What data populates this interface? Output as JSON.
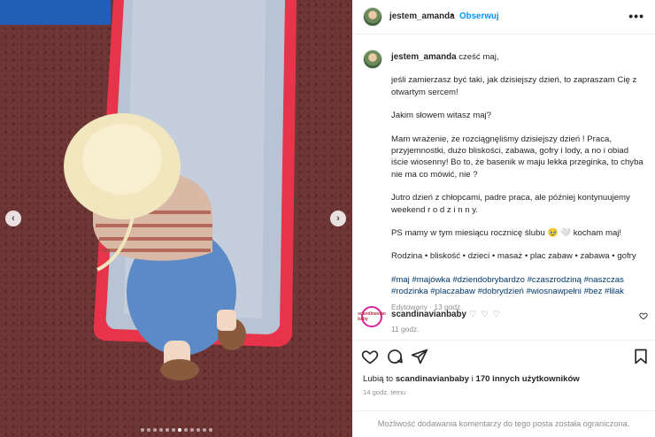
{
  "post": {
    "image": {
      "alt": "Child in a sun hat climbing a playground slide",
      "slide_count": 12,
      "active_slide": 7,
      "prev_label": "‹",
      "next_label": "›"
    },
    "header": {
      "username": "jestem_amanda",
      "separator": "•",
      "follow_label": "Obserwuj",
      "more_label": "•••"
    },
    "caption": {
      "username": "jestem_amanda",
      "first_line": "cześć maj,",
      "paragraphs": [
        "jeśli zamierzasz być taki, jak dzisiejszy dzień, to zapraszam Cię z otwartym sercem!",
        "Jakim słowem witasz maj?",
        "Mam wrażenie, że rozciągnęliśmy dzisiejszy dzień ! Praca, przyjemnostki, dużo bliskości, zabawa, gofry i lody, a no i obiad iście wiosenny! Bo to, że basenik w maju lekka przeginka, to chyba nie ma co mówić, nie ?",
        "Jutro dzień z chłopcami, padre praca, ale później kontynuujemy weekend r o d z i n n y.",
        "PS mamy w tym miesiącu rocznicę ślubu 🥹 🤍 kocham maj!",
        "Rodzina • bliskość • dzieci • masaż • plac zabaw • zabawa • gofry"
      ],
      "hashtags": "#maj #majówka #dziendobrybardzo #czaszrodziną #naszczas #rodzinka #placzabaw #dobrydzień #wiosnawpełni #bez #lilak",
      "edited": "Edytowany · 13 godz."
    },
    "comment": {
      "username": "scandinavianbaby",
      "hearts": "♡ ♡ ♡",
      "time": "11 godz.",
      "avatar_text": "scandinavian baby",
      "like_icon": "heart-icon"
    },
    "actions": {
      "icons": [
        "heart-icon",
        "comment-icon",
        "share-icon",
        "bookmark-icon"
      ],
      "likes_prefix": "Lubią to",
      "likes_user": "scandinavianbaby",
      "likes_mid": "i",
      "likes_others": "170 innych użytkowników",
      "time_ago": "14 godz. temu"
    },
    "restricted": "Możliwość dodawania komentarzy do tego posta została ograniczona.",
    "colors": {
      "accent": "#0095f6",
      "hashtag": "#00376b",
      "muted": "#8e8e8e"
    }
  }
}
